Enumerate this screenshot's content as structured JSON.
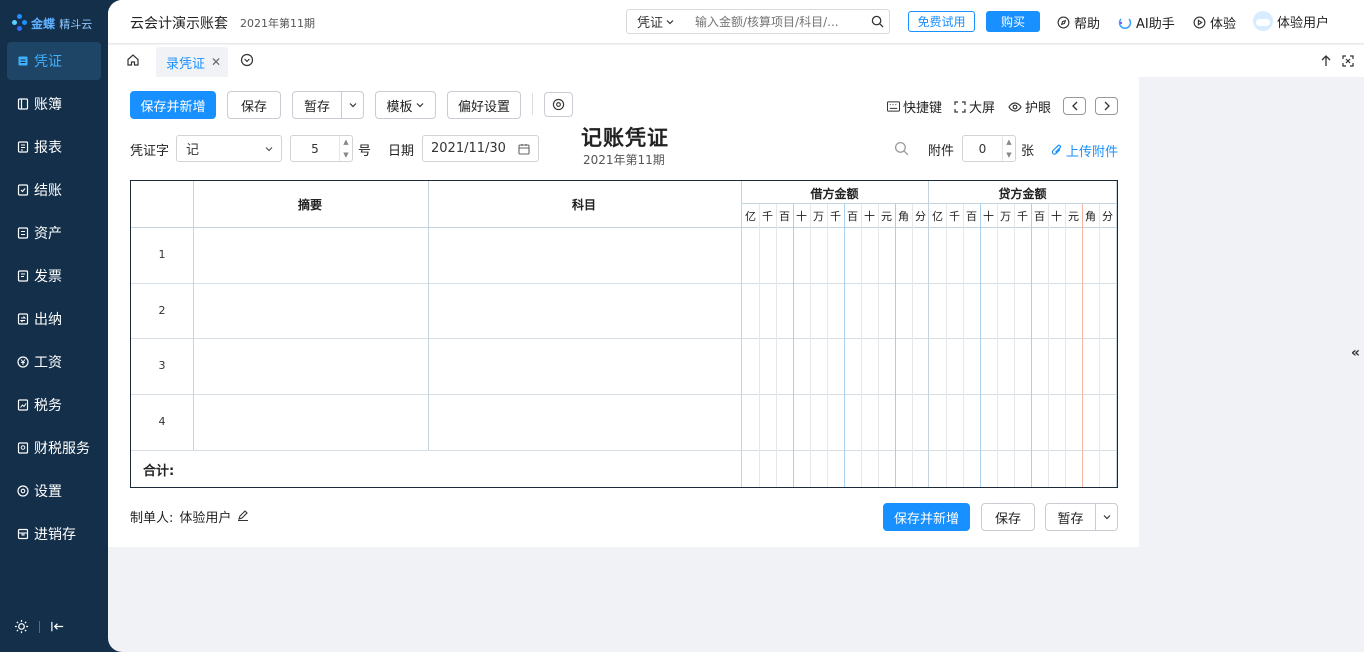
{
  "logo": {
    "brand": "金蝶",
    "product": "精斗云"
  },
  "sidebar": {
    "items": [
      {
        "key": "voucher",
        "label": "凭证",
        "icon": "voucher-icon",
        "active": true
      },
      {
        "key": "ledger",
        "label": "账簿",
        "icon": "ledger-icon",
        "active": false
      },
      {
        "key": "report",
        "label": "报表",
        "icon": "report-icon",
        "active": false
      },
      {
        "key": "closing",
        "label": "结账",
        "icon": "closing-icon",
        "active": false
      },
      {
        "key": "assets",
        "label": "资产",
        "icon": "assets-icon",
        "active": false
      },
      {
        "key": "invoice",
        "label": "发票",
        "icon": "invoice-icon",
        "active": false
      },
      {
        "key": "cashier",
        "label": "出纳",
        "icon": "cashier-icon",
        "active": false
      },
      {
        "key": "payroll",
        "label": "工资",
        "icon": "yen-icon",
        "active": false
      },
      {
        "key": "tax",
        "label": "税务",
        "icon": "tax-icon",
        "active": false
      },
      {
        "key": "taxservice",
        "label": "财税服务",
        "icon": "tax-service-icon",
        "active": false
      },
      {
        "key": "settings",
        "label": "设置",
        "icon": "settings-icon",
        "active": false
      },
      {
        "key": "inventory",
        "label": "进销存",
        "icon": "inventory-icon",
        "active": false
      }
    ]
  },
  "header": {
    "account_name": "云会计演示账套",
    "period": "2021年第11期",
    "search": {
      "type": "凭证",
      "placeholder": "输入金额/核算项目/科目/..."
    },
    "trial": "免费试用",
    "buy": "购买",
    "help": "帮助",
    "ai": "AI助手",
    "experience": "体验",
    "user": "体验用户"
  },
  "tabs": {
    "active_tab": "录凭证"
  },
  "toolbar": {
    "save_new": "保存并新增",
    "save": "保存",
    "hold": "暂存",
    "template": "模板",
    "preferences": "偏好设置",
    "shortcuts": "快捷键",
    "fullscreen": "大屏",
    "eye_care": "护眼"
  },
  "voucher": {
    "word_label": "凭证字",
    "word_value": "记",
    "number": "5",
    "number_suffix": "号",
    "date_label": "日期",
    "date_value": "2021/11/30",
    "title": "记账凭证",
    "period": "2021年第11期",
    "attach_label": "附件",
    "attach_count": "0",
    "attach_unit": "张",
    "upload": "上传附件"
  },
  "table": {
    "col_summary": "摘要",
    "col_subject": "科目",
    "col_debit": "借方金额",
    "col_credit": "贷方金额",
    "digits": [
      "亿",
      "千",
      "百",
      "十",
      "万",
      "千",
      "百",
      "十",
      "元",
      "角",
      "分"
    ],
    "rows": [
      "1",
      "2",
      "3",
      "4"
    ],
    "total_label": "合计:"
  },
  "footer": {
    "maker_label": "制单人:",
    "maker_name": "体验用户",
    "save_new": "保存并新增",
    "save": "保存",
    "hold": "暂存"
  },
  "colors": {
    "accent": "#1890ff",
    "sidebar": "#132f49",
    "active_text": "#3fb1ff"
  }
}
